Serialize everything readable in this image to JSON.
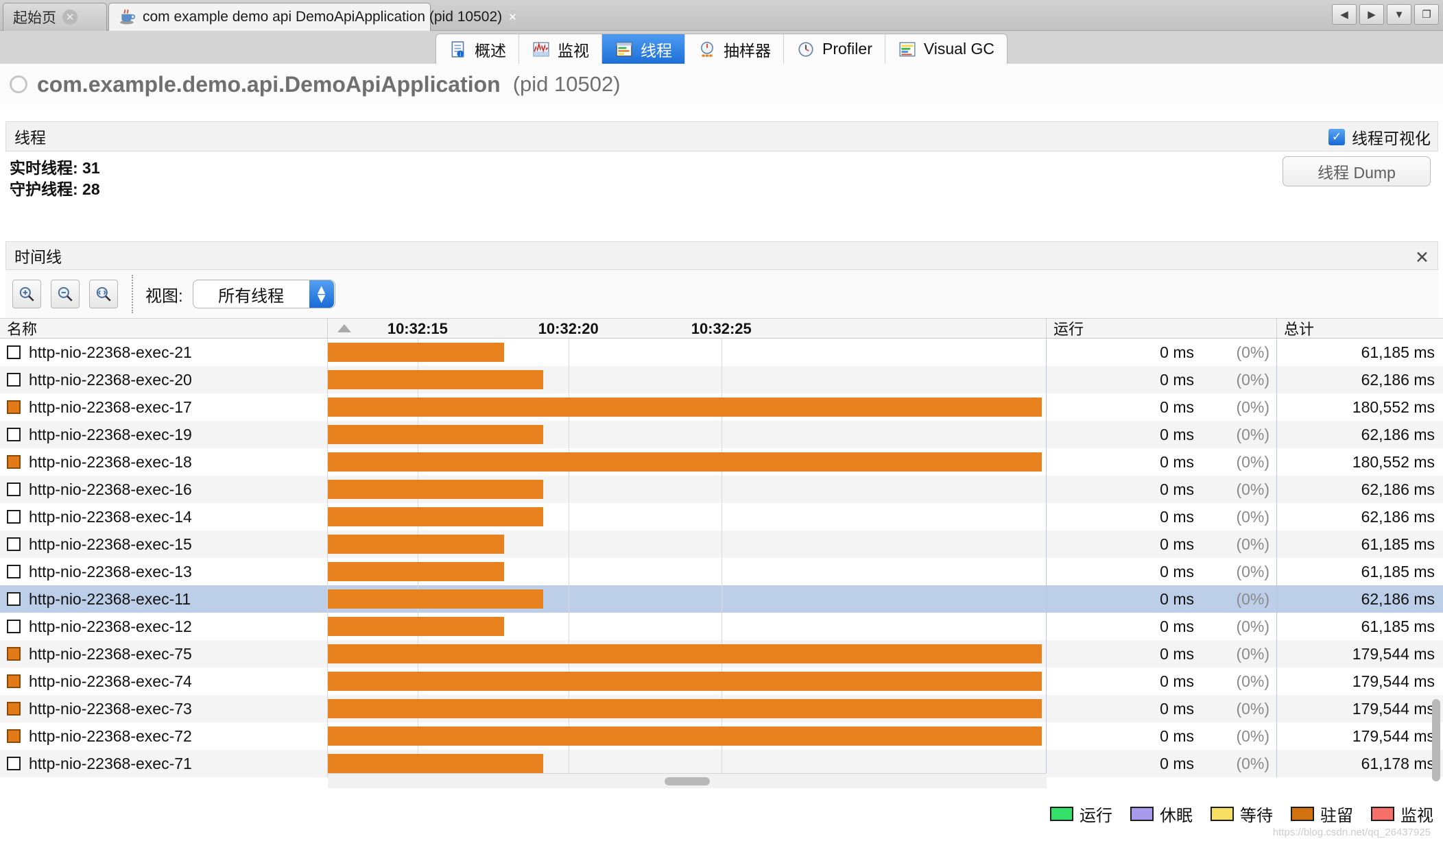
{
  "window": {
    "tabs": [
      {
        "label": "起始页",
        "icon": "none",
        "active": false,
        "close_icon": "close-icon"
      },
      {
        "label": "com example demo api DemoApiApplication (pid 10502)",
        "icon": "java-cup-icon",
        "active": true,
        "close_icon": "close-icon"
      }
    ],
    "nav_buttons": [
      {
        "name": "scroll-left-button",
        "glyph": "◀"
      },
      {
        "name": "scroll-right-button",
        "glyph": "▶"
      },
      {
        "name": "tab-list-button",
        "glyph": "▼"
      },
      {
        "name": "maximize-button",
        "glyph": "❐"
      }
    ]
  },
  "view_tabs": [
    {
      "label": "概述",
      "icon": "overview-icon",
      "selected": false
    },
    {
      "label": "监视",
      "icon": "monitor-icon",
      "selected": false
    },
    {
      "label": "线程",
      "icon": "threads-icon",
      "selected": true
    },
    {
      "label": "抽样器",
      "icon": "sampler-icon",
      "selected": false
    },
    {
      "label": "Profiler",
      "icon": "profiler-icon",
      "selected": false
    },
    {
      "label": "Visual GC",
      "icon": "visualgc-icon",
      "selected": false
    }
  ],
  "header": {
    "app_name": "com.example.demo.api.DemoApiApplication",
    "pid": "(pid 10502)"
  },
  "threads_section": {
    "title": "线程",
    "visualize_label": "线程可视化",
    "visualize_checked": true,
    "live_threads": "实时线程: 31",
    "daemon_threads": "守护线程: 28",
    "dump_button": "线程 Dump"
  },
  "timeline": {
    "title": "时间线",
    "close_glyph": "✕",
    "zoom_buttons": [
      {
        "name": "zoom-in-button",
        "icon": "zoom-in-icon"
      },
      {
        "name": "zoom-out-button",
        "icon": "zoom-out-icon"
      },
      {
        "name": "zoom-fit-button",
        "icon": "zoom-fit-icon"
      }
    ],
    "view_label": "视图:",
    "view_selected": "所有线程",
    "view_options": [
      "所有线程"
    ]
  },
  "table": {
    "columns": {
      "name": "名称",
      "running": "运行",
      "total": "总计"
    },
    "time_ticks": [
      "10:32:15",
      "10:32:20",
      "10:32:25"
    ],
    "tick_positions_pct": [
      12.5,
      33.5,
      54.8
    ],
    "gridline_positions_pct": [
      12.5,
      33.5,
      54.8
    ],
    "sort_column": "chart",
    "rows": [
      {
        "name": "http-nio-22368-exec-21",
        "checked": false,
        "bar_pct": 24.5,
        "running": "0 ms",
        "running_pct": "(0%)",
        "total": "61,185 ms",
        "selected": false
      },
      {
        "name": "http-nio-22368-exec-20",
        "checked": false,
        "bar_pct": 30.0,
        "running": "0 ms",
        "running_pct": "(0%)",
        "total": "62,186 ms",
        "selected": false
      },
      {
        "name": "http-nio-22368-exec-17",
        "checked": true,
        "bar_pct": 99.4,
        "running": "0 ms",
        "running_pct": "(0%)",
        "total": "180,552 ms",
        "selected": false
      },
      {
        "name": "http-nio-22368-exec-19",
        "checked": false,
        "bar_pct": 30.0,
        "running": "0 ms",
        "running_pct": "(0%)",
        "total": "62,186 ms",
        "selected": false
      },
      {
        "name": "http-nio-22368-exec-18",
        "checked": true,
        "bar_pct": 99.4,
        "running": "0 ms",
        "running_pct": "(0%)",
        "total": "180,552 ms",
        "selected": false
      },
      {
        "name": "http-nio-22368-exec-16",
        "checked": false,
        "bar_pct": 30.0,
        "running": "0 ms",
        "running_pct": "(0%)",
        "total": "62,186 ms",
        "selected": false
      },
      {
        "name": "http-nio-22368-exec-14",
        "checked": false,
        "bar_pct": 30.0,
        "running": "0 ms",
        "running_pct": "(0%)",
        "total": "62,186 ms",
        "selected": false
      },
      {
        "name": "http-nio-22368-exec-15",
        "checked": false,
        "bar_pct": 24.5,
        "running": "0 ms",
        "running_pct": "(0%)",
        "total": "61,185 ms",
        "selected": false
      },
      {
        "name": "http-nio-22368-exec-13",
        "checked": false,
        "bar_pct": 24.5,
        "running": "0 ms",
        "running_pct": "(0%)",
        "total": "61,185 ms",
        "selected": false
      },
      {
        "name": "http-nio-22368-exec-11",
        "checked": false,
        "bar_pct": 30.0,
        "running": "0 ms",
        "running_pct": "(0%)",
        "total": "62,186 ms",
        "selected": true
      },
      {
        "name": "http-nio-22368-exec-12",
        "checked": false,
        "bar_pct": 24.5,
        "running": "0 ms",
        "running_pct": "(0%)",
        "total": "61,185 ms",
        "selected": false
      },
      {
        "name": "http-nio-22368-exec-75",
        "checked": true,
        "bar_pct": 99.4,
        "running": "0 ms",
        "running_pct": "(0%)",
        "total": "179,544 ms",
        "selected": false
      },
      {
        "name": "http-nio-22368-exec-74",
        "checked": true,
        "bar_pct": 99.4,
        "running": "0 ms",
        "running_pct": "(0%)",
        "total": "179,544 ms",
        "selected": false
      },
      {
        "name": "http-nio-22368-exec-73",
        "checked": true,
        "bar_pct": 99.4,
        "running": "0 ms",
        "running_pct": "(0%)",
        "total": "179,544 ms",
        "selected": false
      },
      {
        "name": "http-nio-22368-exec-72",
        "checked": true,
        "bar_pct": 99.4,
        "running": "0 ms",
        "running_pct": "(0%)",
        "total": "179,544 ms",
        "selected": false
      },
      {
        "name": "http-nio-22368-exec-71",
        "checked": false,
        "bar_pct": 30.0,
        "running": "0 ms",
        "running_pct": "(0%)",
        "total": "61,178 ms",
        "selected": false
      }
    ]
  },
  "legend": [
    {
      "label": "运行",
      "color": "#33e06a"
    },
    {
      "label": "休眠",
      "color": "#a89aec"
    },
    {
      "label": "等待",
      "color": "#f7e061"
    },
    {
      "label": "驻留",
      "color": "#d2710f"
    },
    {
      "label": "监视",
      "color": "#f6706a"
    }
  ],
  "colors": {
    "bar": "#e8821e",
    "selection": "#bdcfe8",
    "tab_selected": "#1d6fd8"
  },
  "watermark": "https://blog.csdn.net/qq_26437925"
}
